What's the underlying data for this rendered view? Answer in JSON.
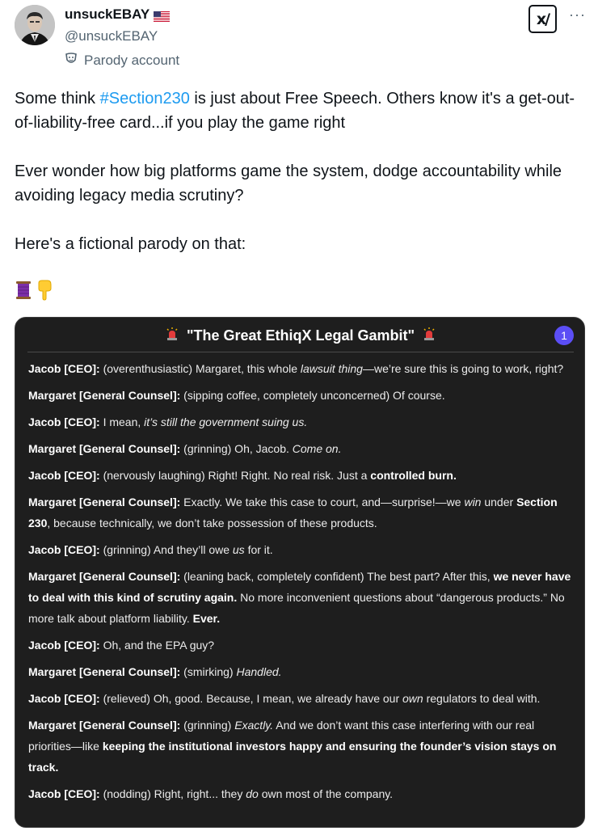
{
  "author": {
    "display_name": "unsuckEBAY",
    "handle": "@unsuckEBAY",
    "label": "Parody account"
  },
  "icons": {
    "avatar": "avatar-photo",
    "flag": "us-flag-icon",
    "parody": "parody-mask-icon",
    "grok": "grok-icon",
    "more": "more-icon",
    "thread": "thread-spool-icon",
    "down": "pointing-down-icon",
    "siren": "siren-icon"
  },
  "colors": {
    "hashtag": "#1d9bf0",
    "card_bg": "#1e1e1e",
    "badge": "#5b4ef5"
  },
  "tweet": {
    "p1_before": "Some think ",
    "p1_hashtag": "#Section230",
    "p1_after": " is just about Free Speech. Others know it's a get-out-of-liability-free card...if you play the game right",
    "p2": "Ever wonder how big platforms game the system, dodge accountability while avoiding legacy media scrutiny?",
    "p3": "Here's a fictional parody on that:",
    "emojis": [
      "🧵",
      "👇"
    ]
  },
  "more_label": "···",
  "card": {
    "title": "\"The Great EthiqX Legal Gambit\"",
    "badge": "1",
    "lines": [
      [
        {
          "t": "Jacob [CEO]:",
          "s": "sp"
        },
        {
          "t": " (overenthusiastic) Margaret, this whole "
        },
        {
          "t": "lawsuit thing",
          "s": "i"
        },
        {
          "t": "—we’re sure this is going to work, right?"
        }
      ],
      [
        {
          "t": "Margaret [General Counsel]:",
          "s": "sp"
        },
        {
          "t": " (sipping coffee, completely unconcerned) Of course."
        }
      ],
      [
        {
          "t": "Jacob [CEO]:",
          "s": "sp"
        },
        {
          "t": " I mean, "
        },
        {
          "t": "it’s still the government suing us.",
          "s": "i"
        }
      ],
      [
        {
          "t": "Margaret [General Counsel]:",
          "s": "sp"
        },
        {
          "t": " (grinning) Oh, Jacob. "
        },
        {
          "t": "Come on.",
          "s": "i"
        }
      ],
      [
        {
          "t": "Jacob [CEO]:",
          "s": "sp"
        },
        {
          "t": " (nervously laughing) Right! Right. No real risk. Just a "
        },
        {
          "t": "controlled burn.",
          "s": "b"
        }
      ],
      [
        {
          "t": "Margaret [General Counsel]:",
          "s": "sp"
        },
        {
          "t": " Exactly. We take this case to court, and—surprise!—we "
        },
        {
          "t": "win",
          "s": "i"
        },
        {
          "t": " under "
        },
        {
          "t": "Section 230",
          "s": "b"
        },
        {
          "t": ", because technically, we don’t take possession of these products."
        }
      ],
      [
        {
          "t": "Jacob [CEO]:",
          "s": "sp"
        },
        {
          "t": " (grinning) And they’ll owe "
        },
        {
          "t": "us",
          "s": "i"
        },
        {
          "t": " for it."
        }
      ],
      [
        {
          "t": "Margaret [General Counsel]:",
          "s": "sp"
        },
        {
          "t": " (leaning back, completely confident) The best part? After this, "
        },
        {
          "t": "we never have to deal with this kind of scrutiny again.",
          "s": "b"
        },
        {
          "t": " No more inconvenient questions about “dangerous products.” No more talk about platform liability. "
        },
        {
          "t": "Ever.",
          "s": "b"
        }
      ],
      [
        {
          "t": "Jacob [CEO]:",
          "s": "sp"
        },
        {
          "t": " Oh, and the EPA guy?"
        }
      ],
      [
        {
          "t": "Margaret [General Counsel]:",
          "s": "sp"
        },
        {
          "t": " (smirking) "
        },
        {
          "t": "Handled.",
          "s": "i"
        }
      ],
      [
        {
          "t": "Jacob [CEO]:",
          "s": "sp"
        },
        {
          "t": " (relieved) Oh, good. Because, I mean, we already have our "
        },
        {
          "t": "own",
          "s": "i"
        },
        {
          "t": " regulators to deal with."
        }
      ],
      [
        {
          "t": "Margaret [General Counsel]:",
          "s": "sp"
        },
        {
          "t": " (grinning) "
        },
        {
          "t": "Exactly.",
          "s": "i"
        },
        {
          "t": " And we don’t want this case interfering with our real priorities—like "
        },
        {
          "t": "keeping the institutional investors happy and ensuring the founder’s vision stays on track.",
          "s": "b"
        }
      ],
      [
        {
          "t": "Jacob [CEO]:",
          "s": "sp"
        },
        {
          "t": " (nodding) Right, right... they "
        },
        {
          "t": "do",
          "s": "i"
        },
        {
          "t": " own most of the company."
        }
      ]
    ]
  }
}
